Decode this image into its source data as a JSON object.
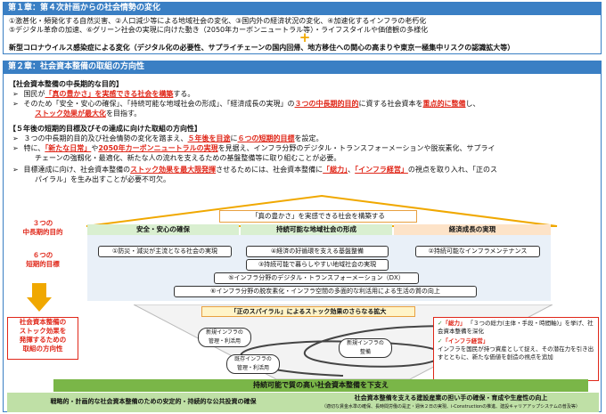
{
  "ch1": {
    "title": "第１章：第４次計画からの社会情勢の変化",
    "line1": "①激甚化・頻発化する自然災害、②人口減少等による地域社会の変化、③国内外の経済状況の変化、④加速化するインフラの老朽化",
    "line2": "⑤デジタル革命の加速、⑥グリーン社会の実現に向けた動き（2050年カーボンニュートラル等）・ライフスタイルや価値観の多様化",
    "plus": "+",
    "line3": "新型コロナウイルス感染症による変化（デジタル化の必要性、サプライチェーンの国内回帰、地方移住への関心の高まりや東京一極集中リスクの認識拡大等）"
  },
  "ch2": {
    "title": "第２章：社会資本整備の取組の方向性",
    "h1": "【社会資本整備の中長期的な目的】",
    "b1a": "国民が",
    "b1b": "「真の豊かさ」を実感できる社会を構築",
    "b1c": "する。",
    "b2a": "そのため「安全・安心の確保」、「持続可能な地域社会の形成」、「経済成長の実現」の",
    "b2b": "３つの中長期的目的",
    "b2c": "に資する社会資本を",
    "b2d": "重点的に整備",
    "b2e": "し、",
    "b2f": "ストック効果が最大化",
    "b2g": "を目指す。",
    "h2": "【５年後の短期的目標及びその達成に向けた取組の方向性】",
    "b3a": "３つの中長期的目的及び社会情勢の変化を踏まえ、",
    "b3b": "５年後を目途",
    "b3c": "に",
    "b3d": "６つの短期的目標",
    "b3e": "を設定。",
    "b4a": "特に、",
    "b4b": "「新たな日常」",
    "b4c": "や",
    "b4d": "2050年カーボンニュートラルの実現",
    "b4e": "を見据え、インフラ分野のデジタル・トランスフォーメーションや脱炭素化、サプライ",
    "b4f": "チェーンの強靱化・最適化、新たな人の流れを支えるための基盤整備等に取り組むことが必要。",
    "b5a": "目標達成に向け、社会資本整備の",
    "b5b": "ストック効果を最大限発揮",
    "b5c": "させるためには、社会資本整備に",
    "b5d": "「総力」",
    "b5e": "、",
    "b5f": "「インフラ経営」",
    "b5g": "の視点を取り入れ、「正のス",
    "b5h": "パイラル」を生み出すことが必要不可欠。"
  },
  "diagram": {
    "top_label": "「真の豊かさ」を実感できる社会を構築する",
    "left1": "３つの\n中長期的目的",
    "left2": "６つの\n短期的目標",
    "left3": "社会資本整備の\nストック効果を\n発揮するための\n取組の方向性",
    "col1": "安全・安心の確保",
    "col2": "持続可能な地域社会の形成",
    "col3": "経済成長の実現",
    "g1": "①防災・減災が主流となる社会の実現",
    "g2": "③持続可能で暮らしやすい地域社会の実現",
    "g3": "④経済の好循環を支える基盤整備",
    "g4": "②持続可能なインフラメンテナンス",
    "g5": "⑤インフラ分野のデジタル・トランスフォーメーション（DX）",
    "g6": "⑥インフラ分野の脱炭素化・インフラ空間の多面的な利活用による生活の質の向上",
    "spiral_title": "「正のスパイラル」によるストック効果のさらなる拡大",
    "s1": "新規インフラの\n管理・利活用",
    "s2": "新規インフラの\n整備",
    "s3": "既存インフラの\n管理・利活用",
    "r1a": "「総力」",
    "r1b": "「３つの総力(主体・手段・時間軸)」を挙げ、社会資本整備を深化",
    "r2a": "「インフラ経営」",
    "r2b": "インフラを国民が持つ資産として捉え、その潜在力を引き出すとともに、新たな価値を創造の視点を追加",
    "bottom1": "持続可能で質の高い社会資本整備を下支え",
    "bottom2a": "戦略的・計画的な社会資本整備のための安定的・持続的な公共投資の確保",
    "bottom2b": "社会資本整備を支える建設産業の担い手の確保・育成や生産性の向上",
    "bottom2c": "（適切な賃金水準の確保、長時間労働の是正・週休２日の実現、i-Constructionの推進、建設キャリアアップシステムの普及等）"
  }
}
